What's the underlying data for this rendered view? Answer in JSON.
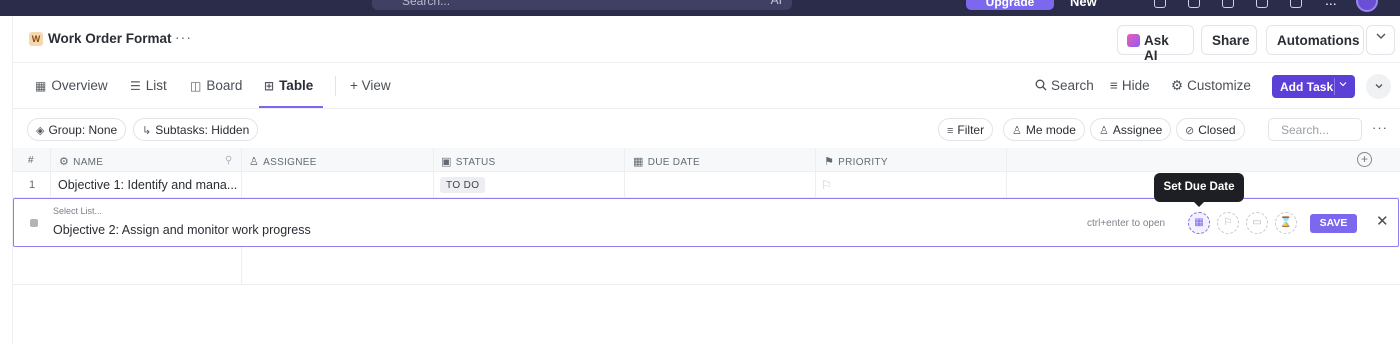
{
  "topbar": {
    "search_placeholder": "Search...",
    "ai_label": "AI",
    "upgrade_label": "Upgrade",
    "new_label": "New",
    "more": "..."
  },
  "header": {
    "workspace_badge": "W",
    "title": "Work Order Format",
    "more": "···",
    "ask_ai": "Ask AI",
    "share": "Share",
    "automations": "Automations"
  },
  "views": {
    "tabs": [
      {
        "icon": "overview-icon",
        "glyph": "▦",
        "label": "Overview"
      },
      {
        "icon": "list-icon",
        "glyph": "☰",
        "label": "List"
      },
      {
        "icon": "board-icon",
        "glyph": "◫",
        "label": "Board"
      },
      {
        "icon": "table-icon",
        "glyph": "⊞",
        "label": "Table"
      }
    ],
    "active_tab": "Table",
    "add_view": "+ View",
    "search": "Search",
    "hide": "Hide",
    "customize": "Customize",
    "add_task": "Add Task"
  },
  "filters": {
    "group": "Group: None",
    "subtasks": "Subtasks: Hidden",
    "filter": "Filter",
    "me_mode": "Me mode",
    "assignee": "Assignee",
    "closed": "Closed",
    "search_placeholder": "Search..."
  },
  "table": {
    "columns": {
      "num": "#",
      "name": "NAME",
      "assignee": "ASSIGNEE",
      "status": "STATUS",
      "due_date": "DUE DATE",
      "priority": "PRIORITY"
    },
    "rows": [
      {
        "num": "1",
        "name": "Objective 1: Identify and mana...",
        "status": "TO DO"
      }
    ]
  },
  "editor": {
    "select_list": "Select List...",
    "text": "Objective 2: Assign and monitor work progress",
    "hint": "ctrl+enter to open",
    "save": "SAVE",
    "tooltip": "Set Due Date"
  },
  "colors": {
    "accent": "#7b68ee",
    "add_task_bg": "#5b3fd6",
    "topbar_bg": "#2b2c4a"
  }
}
